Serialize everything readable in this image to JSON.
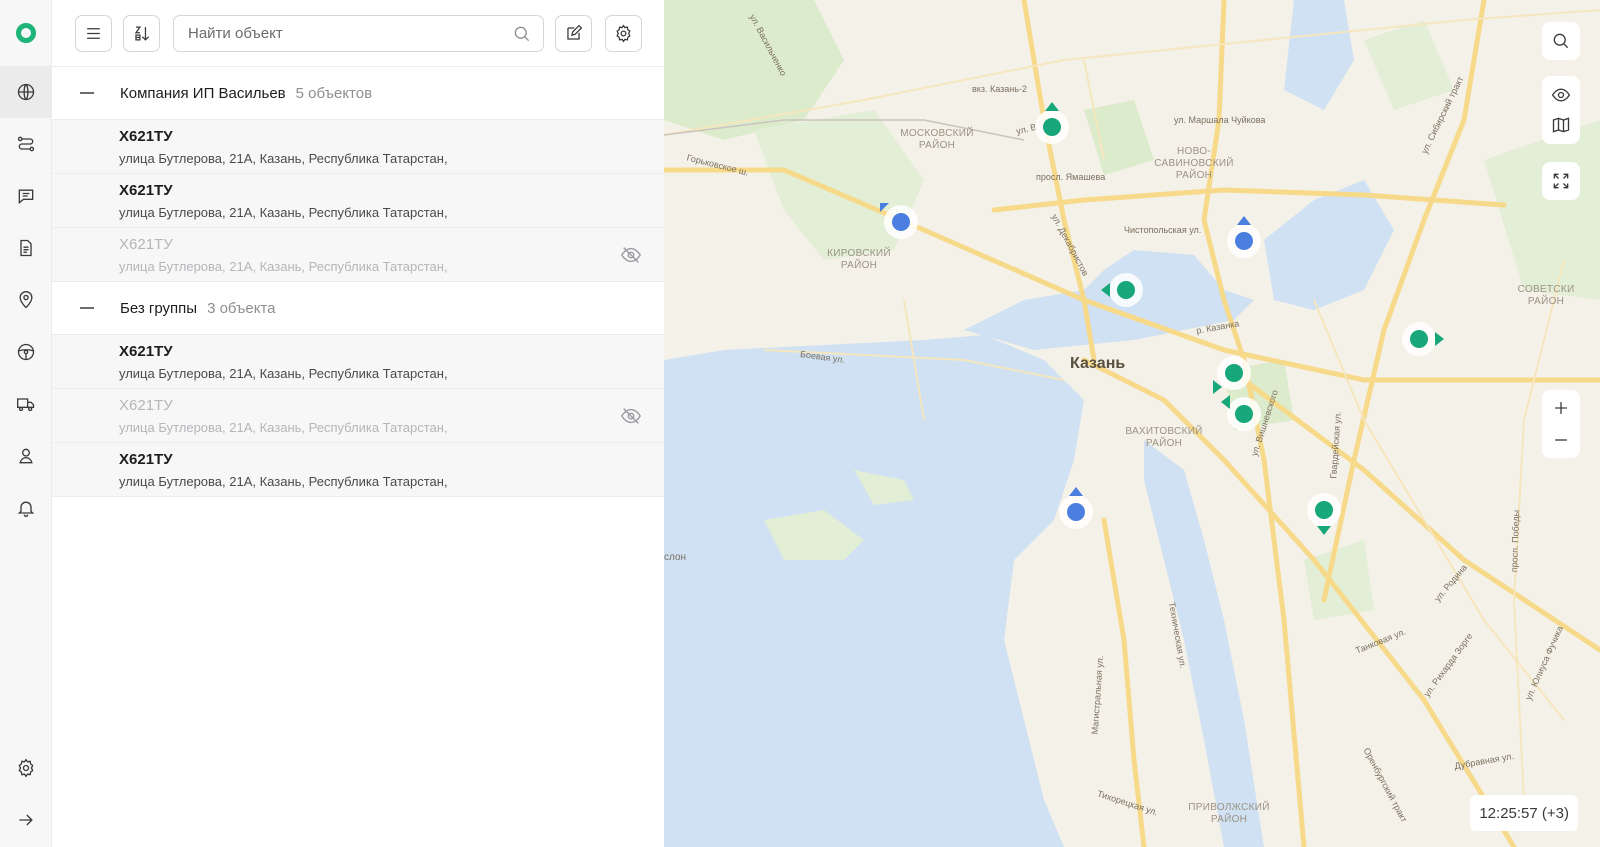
{
  "toolbar": {
    "search_placeholder": "Найти объект"
  },
  "groups": [
    {
      "name": "Компания ИП Васильев",
      "count": "5 объектов",
      "items": [
        {
          "plate": "Х621ТУ",
          "address": "улица Бутлерова, 21А, Казань, Республика Татарстан,",
          "hidden": false
        },
        {
          "plate": "Х621ТУ",
          "address": "улица Бутлерова, 21А, Казань, Республика Татарстан,",
          "hidden": false
        },
        {
          "plate": "Х621ТУ",
          "address": "улица Бутлерова, 21А, Казань, Республика Татарстан,",
          "hidden": true
        }
      ]
    },
    {
      "name": "Без группы",
      "count": "3 объекта",
      "items": [
        {
          "plate": "Х621ТУ",
          "address": "улица Бутлерова, 21А, Казань, Республика Татарстан,",
          "hidden": false
        },
        {
          "plate": "Х621ТУ",
          "address": "улица Бутлерова, 21А, Казань, Республика Татарстан,",
          "hidden": true
        },
        {
          "plate": "Х621ТУ",
          "address": "улица Бутлерова, 21А, Казань, Республика Татарстан,",
          "hidden": false
        }
      ]
    }
  ],
  "map": {
    "city_label": "Казань",
    "district_labels": {
      "moskovsky": "МОСКОВСКИЙ РАЙОН",
      "novo_savinovsky": "НОВО-САВИНОВСКИЙ РАЙОН",
      "kirovsky": "КИРОВСКИЙ РАЙОН",
      "vakhitovsky": "ВАХИТОВСКИЙ РАЙОН",
      "sovetsky": "СОВЕТСКИ РАЙОН",
      "privolzhsky": "ПРИВОЛЖСКИЙ РАЙОН"
    },
    "street_labels": {
      "station": "вкз. Казань-2",
      "marshala": "ул. Маршала Чуйкова",
      "gorkovskoe": "Горьковское ш.",
      "yamasheva": "просл. Ямашева",
      "chistopolskaya": "Чистопольская ул.",
      "dekabristov": "ул. Декабристов",
      "kazanka": "р. Казанка",
      "boevaya": "Боевая ул.",
      "sibirsky": "ул. Сибирский тракт",
      "tekhnicheskaya": "Техническая ул.",
      "magistralnaya": "Магистральная ул.",
      "tikhoretskaya": "Тихорецкая ул.",
      "gvardeyskaya": "Гвардейская ул.",
      "vishnevskogo": "ул. Вишневского",
      "tankovaya": "Танковая ул.",
      "dubravnaya": "Дубравная ул.",
      "orenburgsky": "Оренбургский тракт",
      "pobedy": "просп. Победы",
      "vasilchenko": "ул. Васильченко",
      "sorge": "ул. Рихарда Зорге",
      "fuchika": "ул. Юлиуса Фучика",
      "rodina": "ул. Родина",
      "ul_v": "ул. В",
      "ston": "слон"
    },
    "clock": "12:25:57 (+3)",
    "colors": {
      "green": "#17a77a",
      "blue": "#4a7fe0",
      "water": "#cfe1f3",
      "park": "#dcebcc",
      "road": "#f7d98a"
    }
  }
}
